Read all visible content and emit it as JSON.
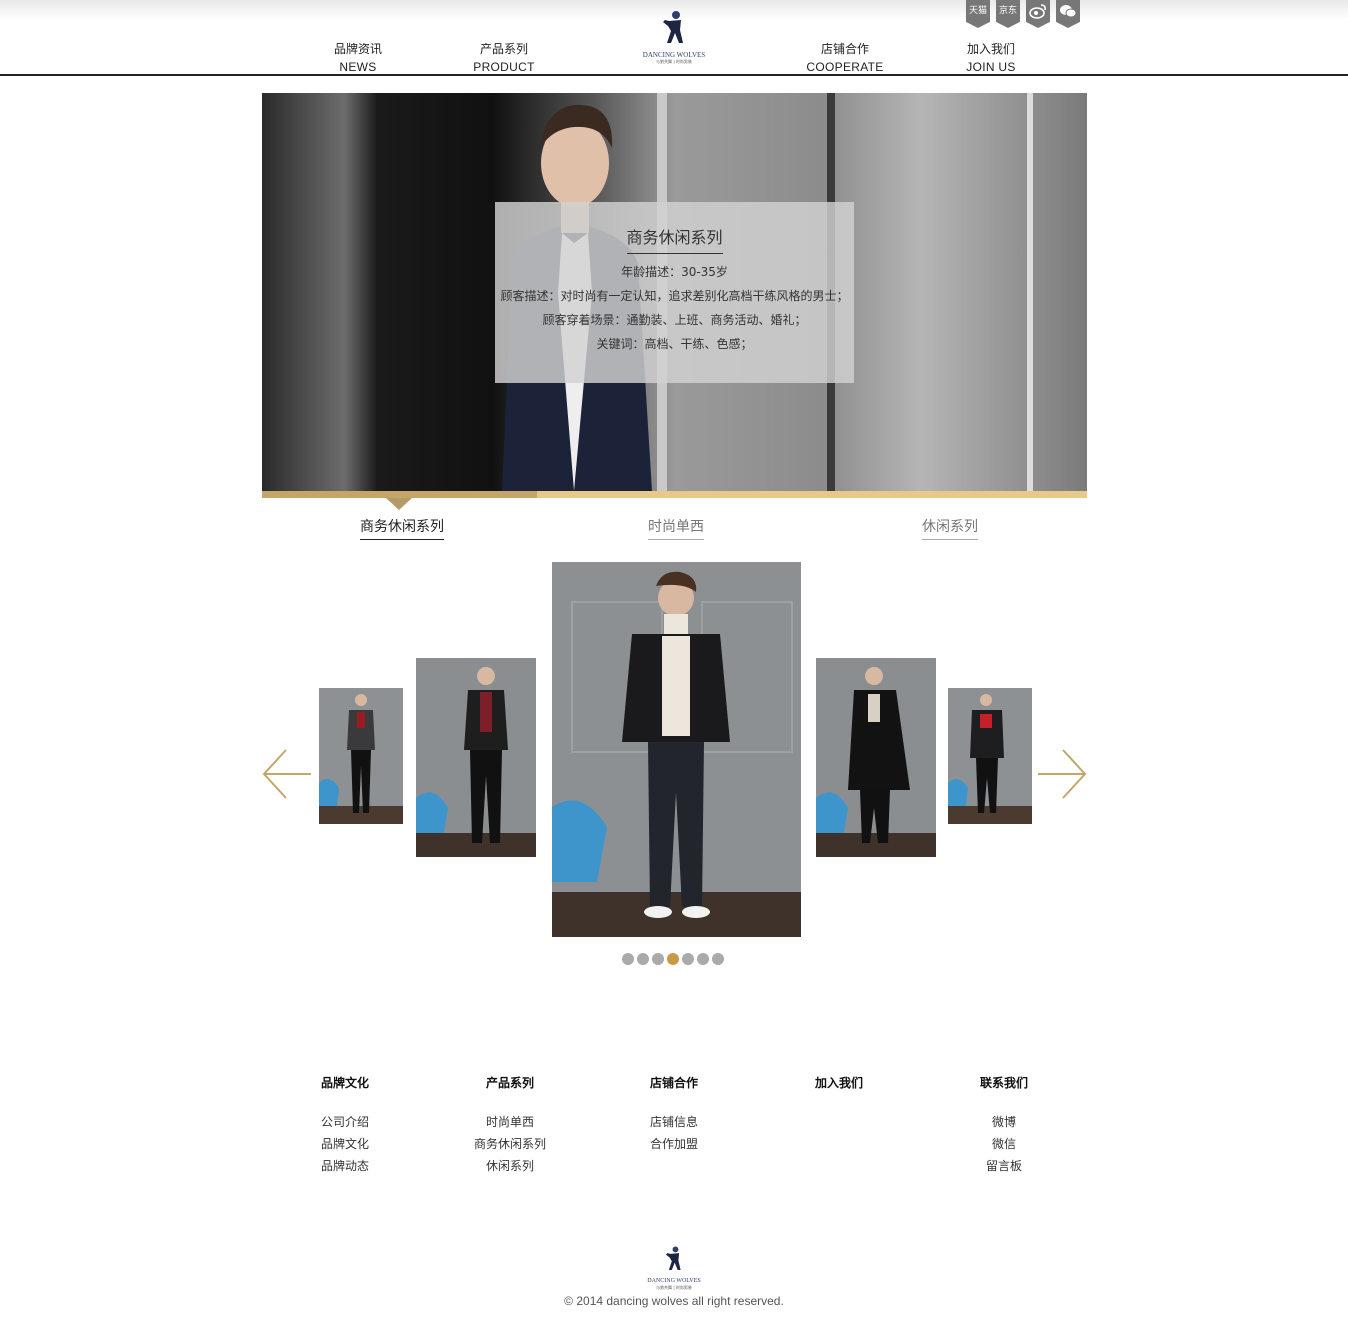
{
  "nav": {
    "items": [
      {
        "cn": "品牌资讯",
        "en": "NEWS"
      },
      {
        "cn": "产品系列",
        "en": "PRODUCT"
      },
      {
        "cn": "店铺合作",
        "en": "COOPERATE"
      },
      {
        "cn": "加入我们",
        "en": "JOIN US"
      }
    ],
    "logo_text": "DANCING WOLVES",
    "logo_sub": "与狼共舞 | 时尚男装",
    "social": [
      "天猫",
      "京东",
      "weibo-icon",
      "wechat-icon"
    ]
  },
  "banner": {
    "title": "商务休闲系列",
    "lines": [
      "年龄描述：30-35岁",
      "顾客描述：对时尚有一定认知，追求差别化高档干练风格的男士；",
      "顾客穿着场景：通勤装、上班、商务活动、婚礼；",
      "关键词：高档、干练、色感；"
    ]
  },
  "tabs": [
    "商务休闲系列",
    "时尚单西",
    "休闲系列"
  ],
  "carousel": {
    "dots": 7,
    "active_dot": 4
  },
  "footer": {
    "columns": [
      {
        "title": "品牌文化",
        "links": [
          "公司介绍",
          "品牌文化",
          "品牌动态"
        ]
      },
      {
        "title": "产品系列",
        "links": [
          "时尚单西",
          "商务休闲系列",
          "休闲系列"
        ]
      },
      {
        "title": "店铺合作",
        "links": [
          "店铺信息",
          "合作加盟"
        ]
      },
      {
        "title": "加入我们",
        "links": []
      },
      {
        "title": "联系我们",
        "links": [
          "微博",
          "微信",
          "留言板"
        ]
      }
    ],
    "copyright": "© 2014 dancing wolves all right reserved."
  },
  "colors": {
    "accent": "#c99a45",
    "gold_bar": "#e7c98a",
    "gold_dark": "#c4a56a"
  }
}
